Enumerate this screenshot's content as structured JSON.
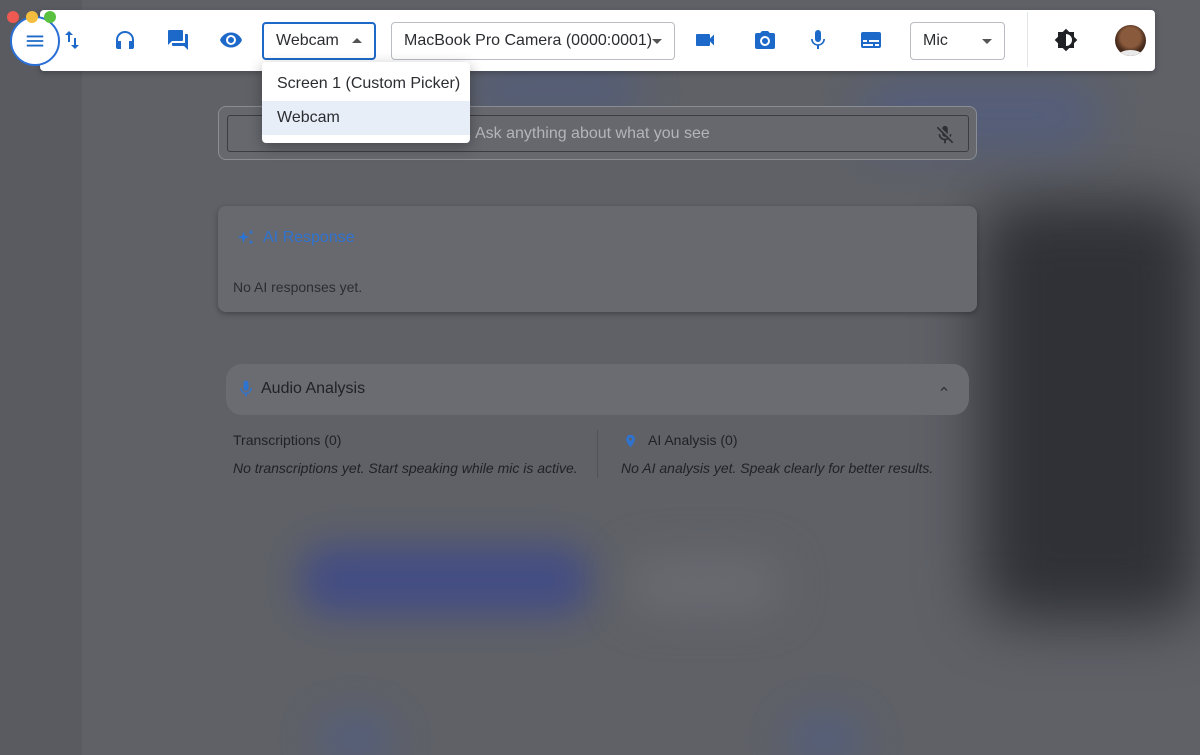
{
  "window_controls": [
    "close",
    "minimize",
    "zoom"
  ],
  "toolbar": {
    "menu_icon": "hamburger-icon",
    "icons": [
      "sort-arrows-icon",
      "headphones-icon",
      "chat-icon",
      "eye-icon",
      "videocam-icon",
      "camera-icon",
      "mic-icon",
      "subtitles-icon",
      "brightness-icon"
    ],
    "source_select": {
      "value": "Webcam",
      "open": true
    },
    "camera_select": {
      "value": "MacBook Pro Camera (0000:0001)"
    },
    "mic_select": {
      "value": "Mic"
    }
  },
  "source_dropdown": {
    "options": [
      {
        "label": "Screen 1 (Custom Picker)",
        "selected": false
      },
      {
        "label": "Webcam",
        "selected": true
      }
    ]
  },
  "search": {
    "placeholder": "Ask anything about what you see"
  },
  "ai_response": {
    "title": "AI Response",
    "empty_text": "No AI responses yet."
  },
  "audio_analysis": {
    "title": "Audio Analysis",
    "transcriptions_title": "Transcriptions (0)",
    "transcriptions_empty": "No transcriptions yet. Start speaking while mic is active.",
    "ai_analysis_title": "AI Analysis (0)",
    "ai_analysis_empty": "No AI analysis yet. Speak clearly for better results."
  },
  "colors": {
    "accent": "#1d69c9",
    "background": "#5f6167",
    "toolbar_bg": "#ffffff"
  }
}
